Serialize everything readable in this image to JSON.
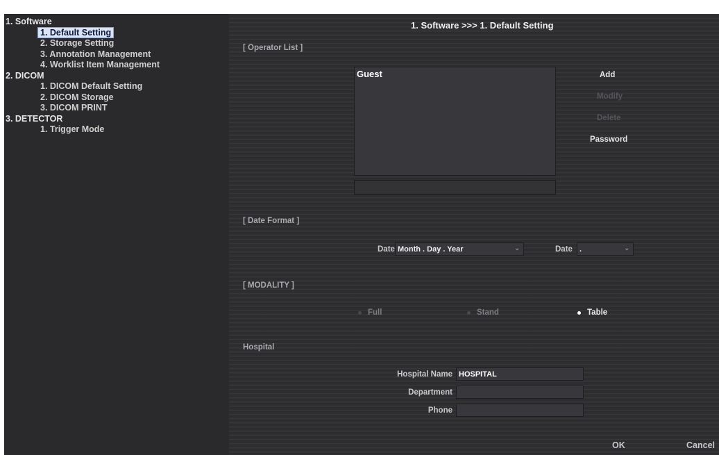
{
  "sidebar": {
    "categories": [
      {
        "label": "1. Software",
        "items": [
          "1. Default Setting",
          "2. Storage Setting",
          "3. Annotation Management",
          "4. Worklist Item Management"
        ]
      },
      {
        "label": "2. DICOM",
        "items": [
          "1. DICOM Default Setting",
          "2. DICOM Storage",
          "3. DICOM PRINT"
        ]
      },
      {
        "label": "3. DETECTOR",
        "items": [
          "1. Trigger Mode"
        ]
      }
    ],
    "selected": "1. Default Setting"
  },
  "main": {
    "breadcrumb": "1. Software >>> 1. Default Setting",
    "operator_list": {
      "section_label": "[ Operator List ]",
      "operators": [
        "Guest"
      ],
      "buttons": {
        "add": "Add",
        "modify": "Modify",
        "delete": "Delete",
        "password": "Password"
      },
      "enabled": {
        "add": true,
        "modify": false,
        "delete": false,
        "password": true
      }
    },
    "date_format": {
      "section_label": "[ Date Format ]",
      "order_label": "Date",
      "order_value": "Month . Day . Year",
      "separator_label": "Date",
      "separator_value": "."
    },
    "modality": {
      "section_label": "[ MODALITY ]",
      "options": [
        "Full",
        "Stand",
        "Table"
      ],
      "selected": "Table"
    },
    "hospital": {
      "section_label": "Hospital",
      "name_label": "Hospital Name",
      "name_value": "HOSPITAL",
      "department_label": "Department",
      "department_value": "",
      "phone_label": "Phone",
      "phone_value": ""
    },
    "footer": {
      "ok": "OK",
      "cancel": "Cancel"
    }
  },
  "icons": {
    "dropdown": "chevron-down-icon",
    "radio": "radio-dot-icon"
  },
  "colors": {
    "selection_bg": "#dbe4f5",
    "panel_bg": "#2e2e31",
    "sidebar_bg": "#2a2a2c"
  }
}
